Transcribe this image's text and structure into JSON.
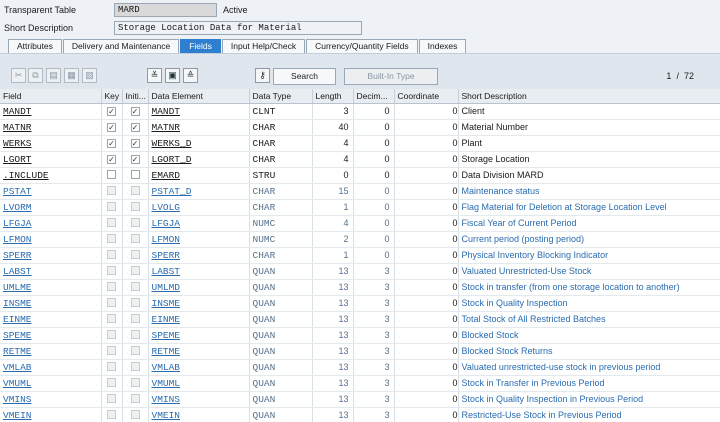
{
  "header": {
    "table_type_label": "Transparent Table",
    "table_name": "MARD",
    "status": "Active",
    "short_desc_label": "Short Description",
    "short_desc_value": "Storage Location Data for Material"
  },
  "tabs": [
    {
      "label": "Attributes",
      "active": false
    },
    {
      "label": "Delivery and Maintenance",
      "active": false
    },
    {
      "label": "Fields",
      "active": true
    },
    {
      "label": "Input Help/Check",
      "active": false
    },
    {
      "label": "Currency/Quantity Fields",
      "active": false
    },
    {
      "label": "Indexes",
      "active": false
    }
  ],
  "toolbar": {
    "icons": [
      "cut-icon",
      "copy-icon",
      "paste-icon",
      "insert-row-icon",
      "delete-row-icon",
      "collapse-icon",
      "hierarchy-icon",
      "expand-icon",
      "key-icon"
    ],
    "search_label": "Search",
    "builtin_label": "Built-In Type",
    "pager_current": "1",
    "pager_sep": "/",
    "pager_total": "72"
  },
  "columns": [
    "Field",
    "Key",
    "Initi...",
    "Data Element",
    "Data Type",
    "Length",
    "Decim...",
    "Coordinate",
    "Short Description"
  ],
  "rows": [
    {
      "field": "MANDT",
      "key": true,
      "init": true,
      "element": "MANDT",
      "type": "CLNT",
      "length": "3",
      "dec": "0",
      "coord": "0",
      "desc": "Client",
      "included": false
    },
    {
      "field": "MATNR",
      "key": true,
      "init": true,
      "element": "MATNR",
      "type": "CHAR",
      "length": "40",
      "dec": "0",
      "coord": "0",
      "desc": "Material Number",
      "included": false
    },
    {
      "field": "WERKS",
      "key": true,
      "init": true,
      "element": "WERKS_D",
      "type": "CHAR",
      "length": "4",
      "dec": "0",
      "coord": "0",
      "desc": "Plant",
      "included": false
    },
    {
      "field": "LGORT",
      "key": true,
      "init": true,
      "element": "LGORT_D",
      "type": "CHAR",
      "length": "4",
      "dec": "0",
      "coord": "0",
      "desc": "Storage Location",
      "included": false
    },
    {
      "field": ".INCLUDE",
      "key": false,
      "init": false,
      "element": "EMARD",
      "type": "STRU",
      "length": "0",
      "dec": "0",
      "coord": "0",
      "desc": "Data Division MARD",
      "included": false
    },
    {
      "field": "PSTAT",
      "key": false,
      "init": false,
      "element": "PSTAT_D",
      "type": "CHAR",
      "length": "15",
      "dec": "0",
      "coord": "0",
      "desc": "Maintenance status",
      "included": true
    },
    {
      "field": "LVORM",
      "key": false,
      "init": false,
      "element": "LVOLG",
      "type": "CHAR",
      "length": "1",
      "dec": "0",
      "coord": "0",
      "desc": "Flag Material for Deletion at Storage Location Level",
      "included": true
    },
    {
      "field": "LFGJA",
      "key": false,
      "init": false,
      "element": "LFGJA",
      "type": "NUMC",
      "length": "4",
      "dec": "0",
      "coord": "0",
      "desc": "Fiscal Year of Current Period",
      "included": true
    },
    {
      "field": "LFMON",
      "key": false,
      "init": false,
      "element": "LFMON",
      "type": "NUMC",
      "length": "2",
      "dec": "0",
      "coord": "0",
      "desc": "Current period (posting period)",
      "included": true
    },
    {
      "field": "SPERR",
      "key": false,
      "init": false,
      "element": "SPERR",
      "type": "CHAR",
      "length": "1",
      "dec": "0",
      "coord": "0",
      "desc": "Physical Inventory Blocking Indicator",
      "included": true
    },
    {
      "field": "LABST",
      "key": false,
      "init": false,
      "element": "LABST",
      "type": "QUAN",
      "length": "13",
      "dec": "3",
      "coord": "0",
      "desc": "Valuated Unrestricted-Use Stock",
      "included": true
    },
    {
      "field": "UMLME",
      "key": false,
      "init": false,
      "element": "UMLMD",
      "type": "QUAN",
      "length": "13",
      "dec": "3",
      "coord": "0",
      "desc": "Stock in transfer (from one storage location to another)",
      "included": true
    },
    {
      "field": "INSME",
      "key": false,
      "init": false,
      "element": "INSME",
      "type": "QUAN",
      "length": "13",
      "dec": "3",
      "coord": "0",
      "desc": "Stock in Quality Inspection",
      "included": true
    },
    {
      "field": "EINME",
      "key": false,
      "init": false,
      "element": "EINME",
      "type": "QUAN",
      "length": "13",
      "dec": "3",
      "coord": "0",
      "desc": "Total Stock of All Restricted Batches",
      "included": true
    },
    {
      "field": "SPEME",
      "key": false,
      "init": false,
      "element": "SPEME",
      "type": "QUAN",
      "length": "13",
      "dec": "3",
      "coord": "0",
      "desc": "Blocked Stock",
      "included": true
    },
    {
      "field": "RETME",
      "key": false,
      "init": false,
      "element": "RETME",
      "type": "QUAN",
      "length": "13",
      "dec": "3",
      "coord": "0",
      "desc": "Blocked Stock Returns",
      "included": true
    },
    {
      "field": "VMLAB",
      "key": false,
      "init": false,
      "element": "VMLAB",
      "type": "QUAN",
      "length": "13",
      "dec": "3",
      "coord": "0",
      "desc": "Valuated unrestricted-use stock in previous period",
      "included": true
    },
    {
      "field": "VMUML",
      "key": false,
      "init": false,
      "element": "VMUML",
      "type": "QUAN",
      "length": "13",
      "dec": "3",
      "coord": "0",
      "desc": "Stock in Transfer in Previous Period",
      "included": true
    },
    {
      "field": "VMINS",
      "key": false,
      "init": false,
      "element": "VMINS",
      "type": "QUAN",
      "length": "13",
      "dec": "3",
      "coord": "0",
      "desc": "Stock in Quality Inspection in Previous Period",
      "included": true
    },
    {
      "field": "VMEIN",
      "key": false,
      "init": false,
      "element": "VMEIN",
      "type": "QUAN",
      "length": "13",
      "dec": "3",
      "coord": "0",
      "desc": "Restricted-Use Stock in Previous Period",
      "included": true
    }
  ]
}
